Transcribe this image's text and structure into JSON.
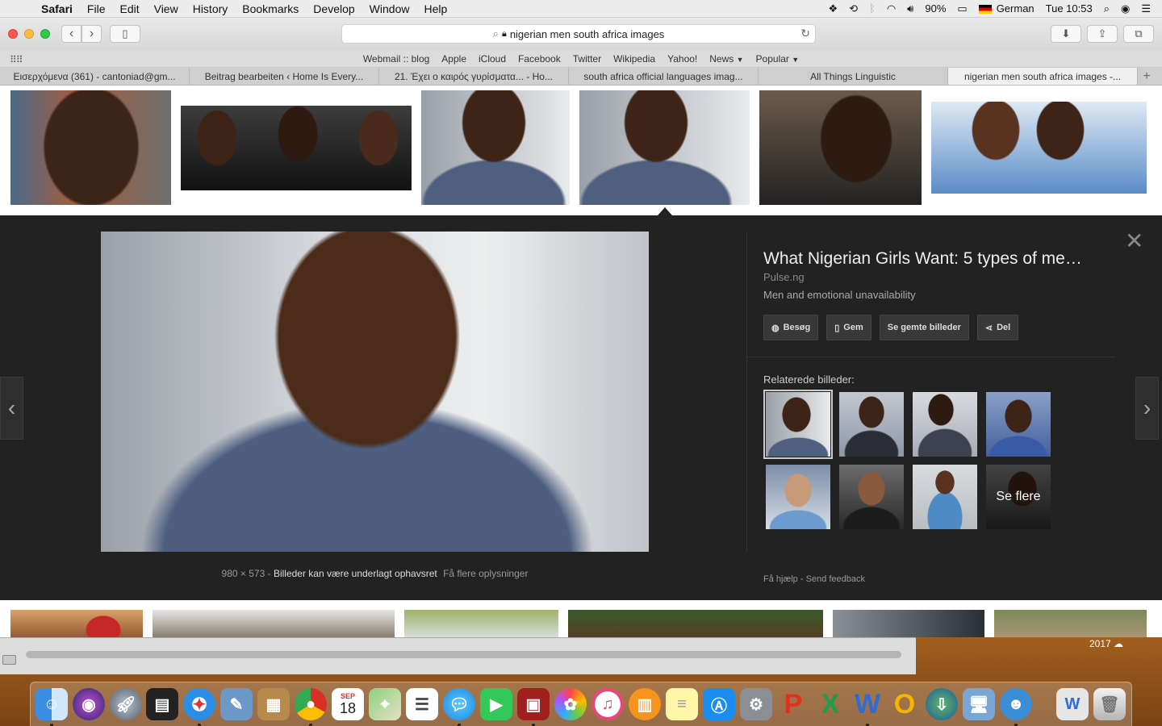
{
  "menubar": {
    "app": "Safari",
    "menus": [
      "File",
      "Edit",
      "View",
      "History",
      "Bookmarks",
      "Develop",
      "Window",
      "Help"
    ],
    "battery": "90%",
    "input_language": "German",
    "clock": "Tue 10:53"
  },
  "address_bar": {
    "url": "nigerian men south africa images"
  },
  "bookmarks": [
    "Webmail :: blog",
    "Apple",
    "iCloud",
    "Facebook",
    "Twitter",
    "Wikipedia",
    "Yahoo!",
    "News",
    "Popular"
  ],
  "tabs": [
    {
      "label": "Εισερχόμενα (361) - cantoniad@gm..."
    },
    {
      "label": "Beitrag bearbeiten ‹ Home Is Every..."
    },
    {
      "label": "21. Έχει ο καιρός γυρίσματα... - Ho..."
    },
    {
      "label": "south africa official languages imag..."
    },
    {
      "label": "All Things Linguistic"
    },
    {
      "label": "nigerian men south africa images -..."
    }
  ],
  "viewer": {
    "title": "What Nigerian Girls Want: 5 types of me…",
    "site": "Pulse.ng",
    "description": "Men and emotional unavailability",
    "actions": {
      "visit": "Besøg",
      "save": "Gem",
      "saved_images": "Se gemte billeder",
      "share": "Del"
    },
    "related_label": "Relaterede billeder:",
    "see_more": "Se flere",
    "dimensions": "980 × 573",
    "copyright_notice": "Billeder kan være underlagt ophavsret",
    "more_info": "Få flere oplysninger",
    "help": "Få hjælp",
    "feedback": "Send feedback"
  },
  "desktop": {
    "year_label": "2017"
  },
  "dock": {
    "calendar_month": "SEP",
    "calendar_day": "18"
  }
}
